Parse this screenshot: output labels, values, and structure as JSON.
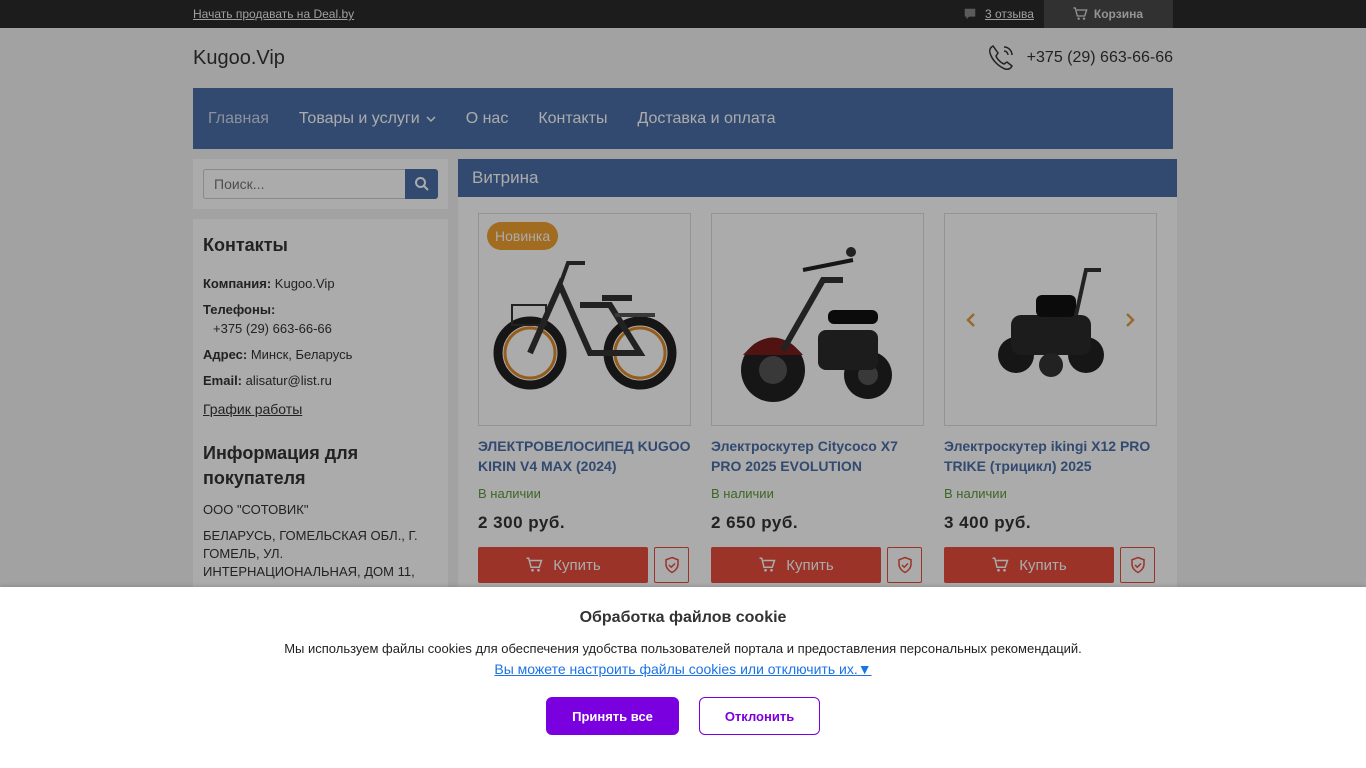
{
  "topbar": {
    "sell_link": "Начать продавать на Deal.by",
    "reviews": "3 отзыва",
    "cart": "Корзина"
  },
  "header": {
    "logo": "Kugoo.Vip",
    "phone": "+375 (29) 663-66-66"
  },
  "nav": {
    "items": [
      {
        "label": "Главная"
      },
      {
        "label": "Товары и услуги"
      },
      {
        "label": "О нас"
      },
      {
        "label": "Контакты"
      },
      {
        "label": "Доставка и оплата"
      }
    ]
  },
  "search": {
    "placeholder": "Поиск..."
  },
  "contacts": {
    "title": "Контакты",
    "company_label": "Компания:",
    "company": "Kugoo.Vip",
    "phones_label": "Телефоны:",
    "phone": "+375 (29) 663-66-66",
    "address_label": "Адрес:",
    "address": "Минск, Беларусь",
    "email_label": "Email:",
    "email": "alisatur@list.ru",
    "schedule_link": "График работы"
  },
  "buyer_info": {
    "title": "Информация для покупателя",
    "org": "ООО \"СОТОВИК\"",
    "addr": "БЕЛАРУСЬ, ГОМЕЛЬСКАЯ ОБЛ., Г. ГОМЕЛЬ, УЛ. ИНТЕРНАЦИОНАЛЬНАЯ, ДОМ 11,"
  },
  "showcase": {
    "title": "Витрина",
    "products": [
      {
        "badge": "Новинка",
        "title": "ЭЛЕКТРОВЕЛОСИПЕД KUGOO KIRIN V4 MAX (2024)",
        "stock": "В наличии",
        "price": "2 300 руб.",
        "buy": "Купить"
      },
      {
        "badge": "",
        "title": "Электроскутер Citycoco X7 PRO 2025 EVOLUTION",
        "stock": "В наличии",
        "price": "2 650 руб.",
        "buy": "Купить"
      },
      {
        "badge": "",
        "title": "Электроскутер ikingi X12 PRO TRIKE (трицикл) 2025",
        "stock": "В наличии",
        "price": "3 400 руб.",
        "buy": "Купить"
      }
    ]
  },
  "cookie": {
    "title": "Обработка файлов cookie",
    "text": "Мы используем файлы cookies для обеспечения удобства пользователей портала и предоставления персональных рекомендаций.",
    "link": "Вы можете настроить файлы cookies или отключить их.▼",
    "accept": "Принять все",
    "decline": "Отклонить"
  },
  "colors": {
    "nav": "#4b6fa8",
    "buy": "#e74c3c",
    "accept": "#7b00e0",
    "badge": "#f0a030",
    "stock": "#5a9a3a"
  },
  "icons": [
    "chat-icon",
    "cart-icon",
    "phone-icon",
    "chevron-down-icon",
    "search-icon",
    "shield-icon",
    "arrow-left-icon",
    "arrow-right-icon"
  ]
}
